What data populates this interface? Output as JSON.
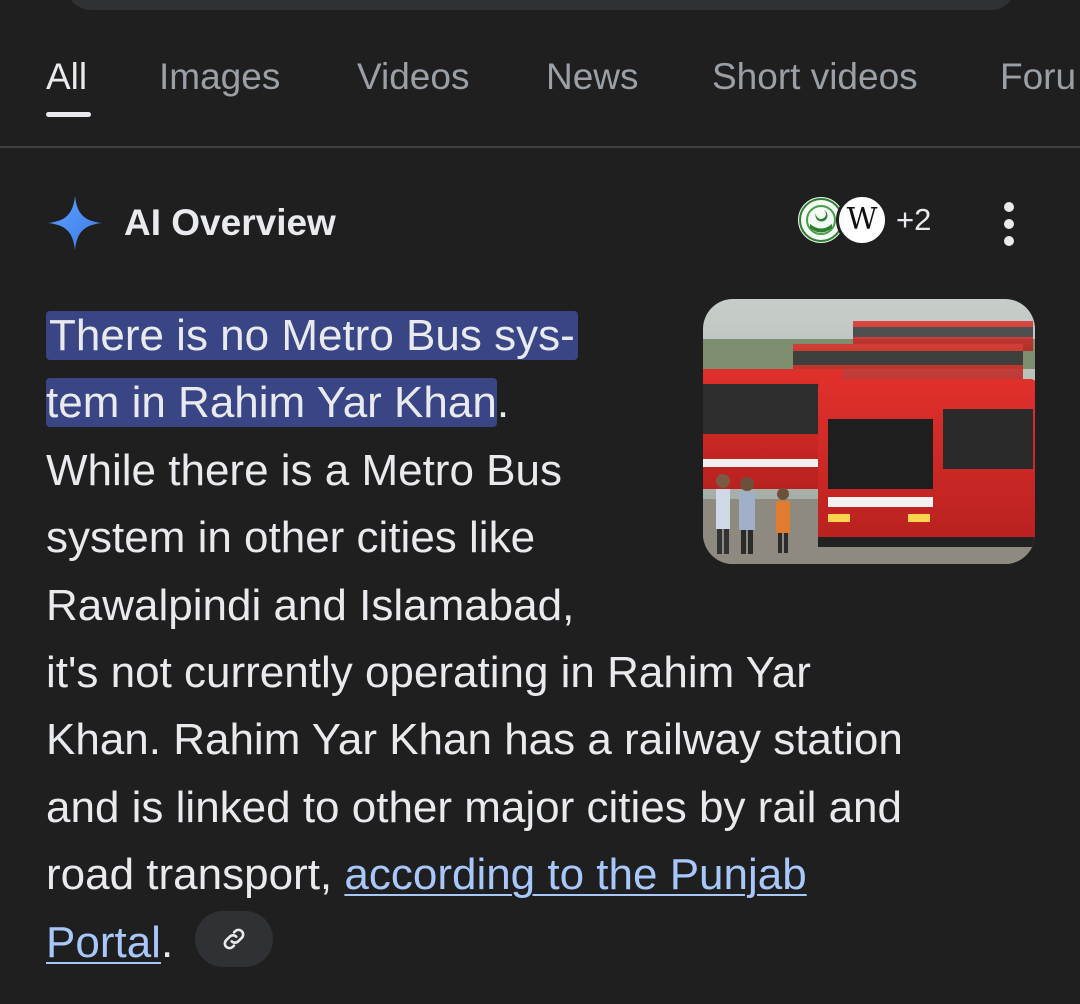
{
  "tabs": [
    {
      "label": "All",
      "active": true
    },
    {
      "label": "Images",
      "active": false
    },
    {
      "label": "Videos",
      "active": false
    },
    {
      "label": "News",
      "active": false
    },
    {
      "label": "Short videos",
      "active": false
    },
    {
      "label": "Foru",
      "active": false
    }
  ],
  "ai_overview": {
    "icon": "sparkle-icon",
    "title": "AI Overview",
    "sources": {
      "icons": [
        "punjab-seal-icon",
        "wikipedia-icon"
      ],
      "wiki_glyph": "W",
      "more_count": "+2"
    },
    "image": "photo of red metro buses",
    "highlight_line1": "There is no Metro Bus sys-",
    "highlight_line2": "tem in Rahim Yar Khan",
    "period": ".",
    "lines": [
      "While there is a Metro Bus",
      "system in other cities like",
      "Rawalpindi and Islamabad,",
      "it's not currently operating in Rahim Yar",
      "Khan. Rahim Yar Khan has a railway station",
      "and is linked to other major cities by rail and"
    ],
    "line9_text": "road transport, ",
    "link_part1": "according to the Punjab",
    "link_part2": "Portal",
    "link_chip_icon": "link-icon"
  },
  "colors": {
    "background": "#1f1f1f",
    "highlight": "#394584",
    "link": "#a8c7fa",
    "sparkle": "#4c8df6"
  }
}
